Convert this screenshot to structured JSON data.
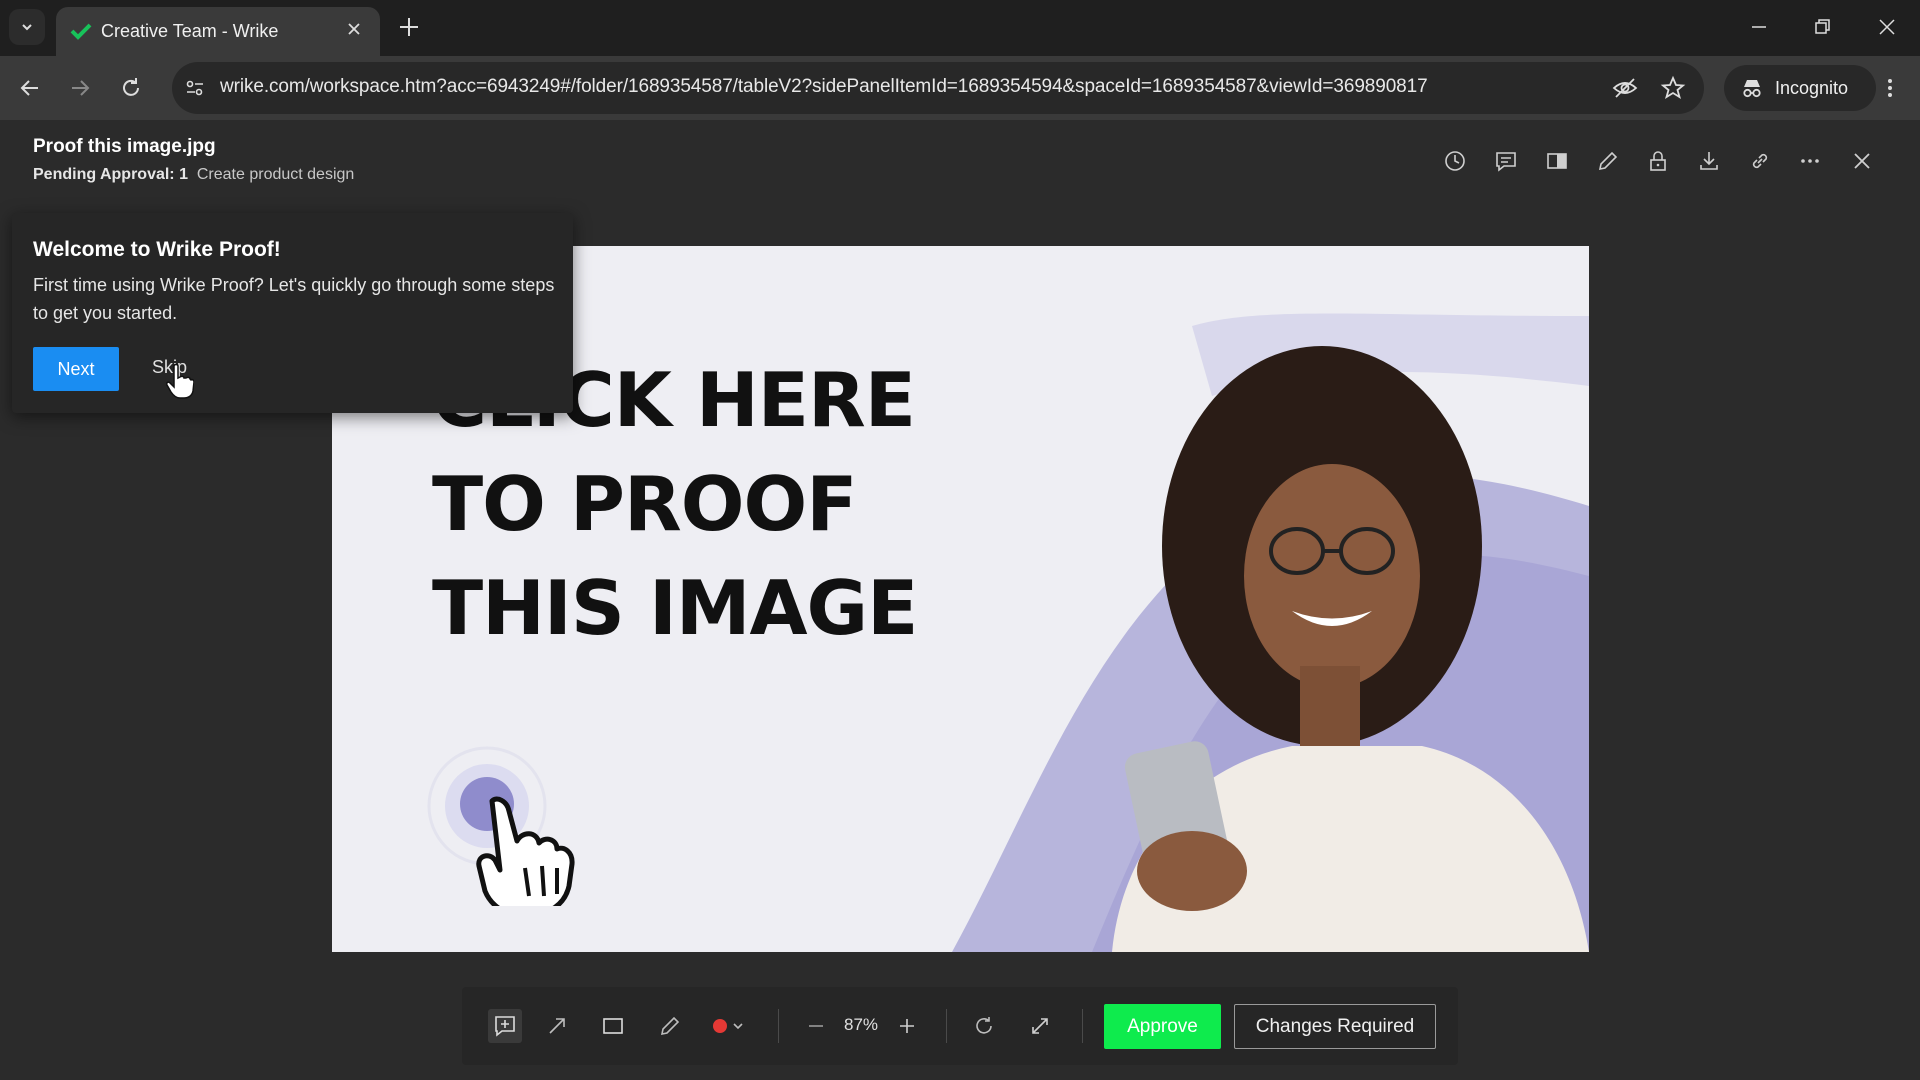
{
  "browser": {
    "tab_title": "Creative Team - Wrike",
    "url": "wrike.com/workspace.htm?acc=6943249#/folder/1689354587/tableV2?sidePanelItemId=1689354594&spaceId=1689354587&viewId=369890817",
    "incognito_label": "Incognito"
  },
  "header": {
    "file_title": "Proof this image.jpg",
    "pending_label": "Pending Approval: 1",
    "task_name": "Create product design",
    "actions": [
      "history-icon",
      "comments-icon",
      "compare-icon",
      "edit-icon",
      "lock-icon",
      "download-icon",
      "link-icon",
      "more-icon",
      "close-icon"
    ]
  },
  "image": {
    "headline_lines": [
      "CLICK HERE",
      "TO PROOF",
      "THIS IMAGE"
    ]
  },
  "welcome": {
    "title": "Welcome to Wrike Proof!",
    "body": "First time using Wrike Proof? Let's quickly go through some steps to get you started.",
    "next_label": "Next",
    "skip_label": "Skip"
  },
  "bottom_bar": {
    "zoom": "87%",
    "approve_label": "Approve",
    "changes_label": "Changes Required",
    "colors": {
      "approve": "#0eeb4d",
      "annotation": "#e53935"
    }
  }
}
